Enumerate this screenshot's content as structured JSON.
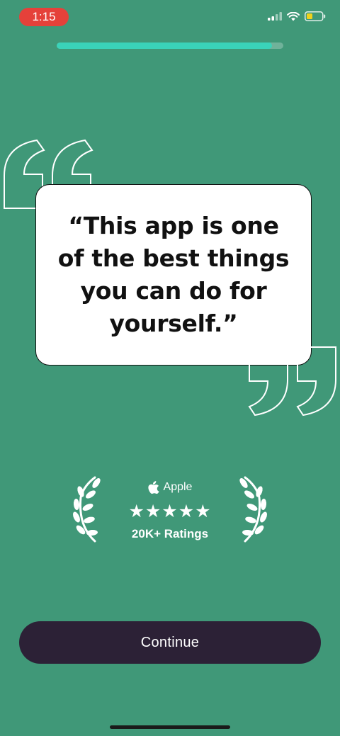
{
  "status_bar": {
    "time": "1:15",
    "battery_color": "#f0d21c",
    "time_pill_color": "#e5413a"
  },
  "progress": {
    "fraction": 0.95,
    "fill_color": "#3ad3b9"
  },
  "quote": {
    "text": "“This app is one of the best things you can do for yourself.”"
  },
  "rating": {
    "brand_icon": "apple-icon",
    "brand": "Apple",
    "stars": 5,
    "count_label": "20K+ Ratings"
  },
  "actions": {
    "continue_label": "Continue"
  },
  "colors": {
    "background": "#409878",
    "card": "#ffffff",
    "button": "#2c2136"
  }
}
